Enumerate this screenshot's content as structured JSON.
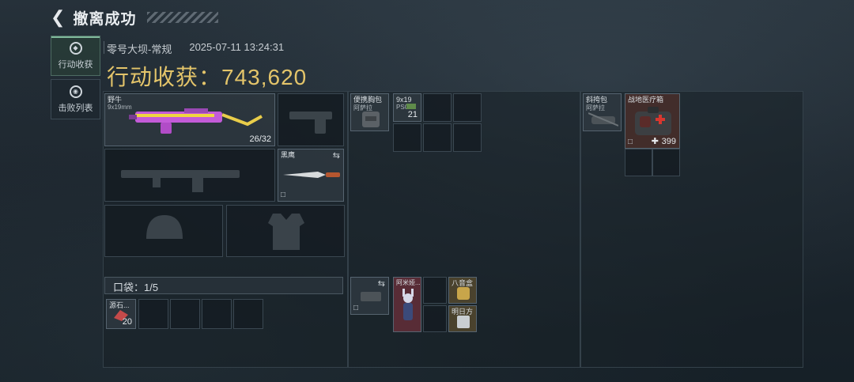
{
  "header": {
    "back_icon": "chevron-left-icon",
    "title": "撤离成功"
  },
  "sidebar": {
    "tabs": [
      {
        "label": "行动收获",
        "icon": "loot-icon",
        "active": true
      },
      {
        "label": "击败列表",
        "icon": "skull-icon",
        "active": false
      }
    ]
  },
  "summary": {
    "map": "零号大坝-常规",
    "datetime": "2025-07-11 13:24:31",
    "total_label": "行动收获：743,620"
  },
  "loadout": {
    "primary": {
      "name": "野牛",
      "caliber": "9x19mm",
      "ammo": "26/32"
    },
    "melee": {
      "name": "黑鹰",
      "icon": "swap-icon"
    },
    "pocket_label": "口袋：1/5",
    "pocket_item": {
      "name": "源石...",
      "count": "20"
    }
  },
  "chest_rig": {
    "items": [
      {
        "name": "便携胸包",
        "sub": "阿萨拉"
      },
      {
        "name": "9x19",
        "sub": "PSO",
        "count": "21"
      }
    ]
  },
  "backpack_area": {
    "items": [
      {
        "name": "阿米娅..."
      },
      {
        "name": "八音盒"
      },
      {
        "name": "明日方"
      }
    ]
  },
  "bag": {
    "items": [
      {
        "name": "斜挎包",
        "sub": "阿萨拉"
      },
      {
        "name": "战地医疗箱",
        "count": "399"
      }
    ]
  },
  "colors": {
    "accent_gold": "#e3c46a",
    "active_tab": "#7fb89b"
  }
}
